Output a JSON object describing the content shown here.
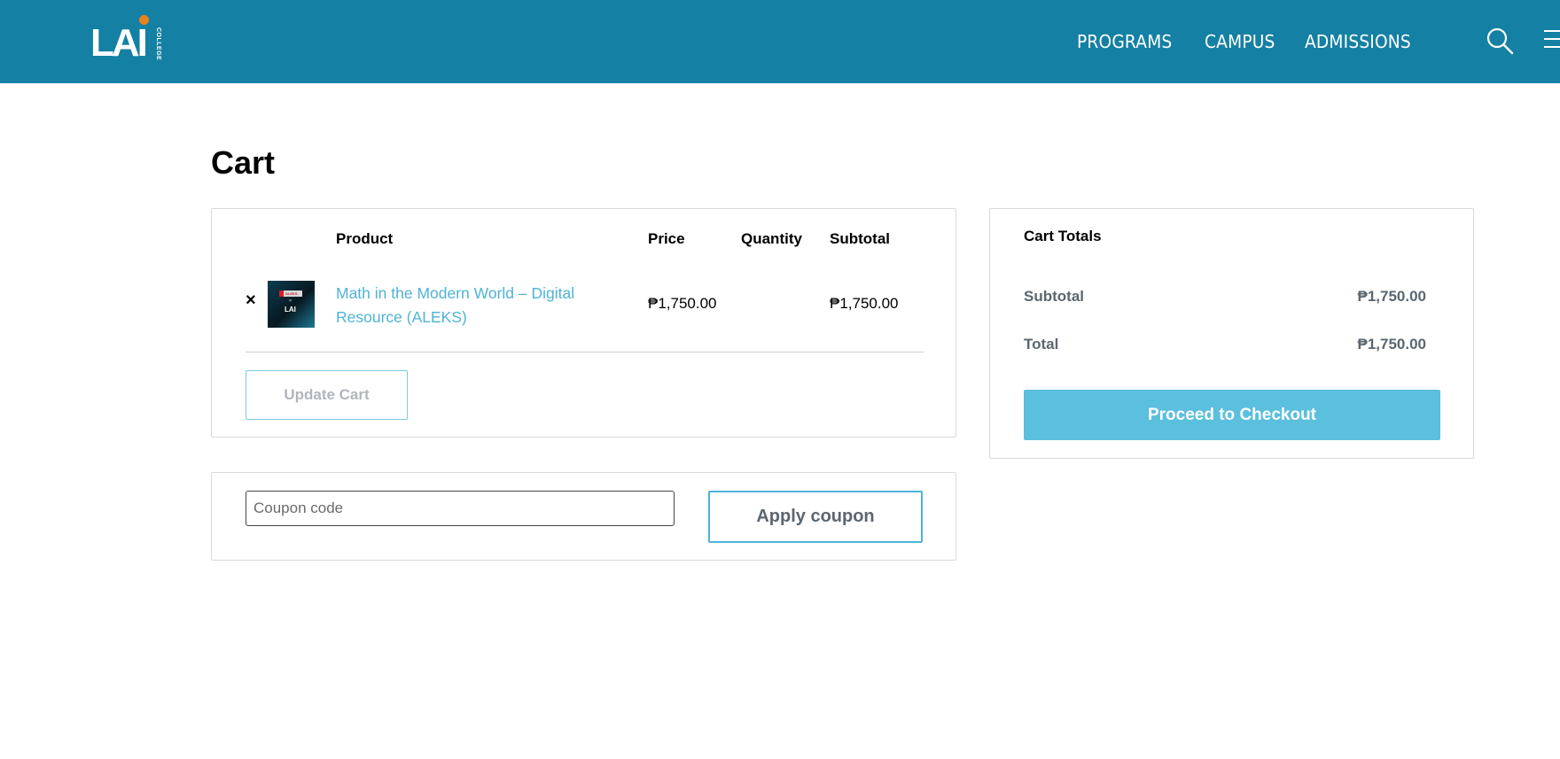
{
  "header": {
    "logo_text": "LAI",
    "logo_sub": "COLLEGE",
    "nav": [
      "PROGRAMS",
      "CAMPUS",
      "ADMISSIONS"
    ]
  },
  "page": {
    "title": "Cart"
  },
  "cart_table": {
    "headers": {
      "product": "Product",
      "price": "Price",
      "quantity": "Quantity",
      "subtotal": "Subtotal"
    },
    "items": [
      {
        "remove_glyph": "×",
        "name": "Math in the Modern World – Digital Resource (ALEKS)",
        "price": "₱1,750.00",
        "quantity": "",
        "subtotal": "₱1,750.00",
        "thumbnail": {
          "brand": "ALEKS",
          "x": "×",
          "lai": "LAI"
        }
      }
    ],
    "update_button": "Update Cart"
  },
  "coupon": {
    "placeholder": "Coupon code",
    "apply_button": "Apply coupon"
  },
  "cart_totals": {
    "title": "Cart Totals",
    "subtotal_label": "Subtotal",
    "subtotal_value": "₱1,750.00",
    "total_label": "Total",
    "total_value": "₱1,750.00",
    "checkout_button": "Proceed to Checkout"
  },
  "colors": {
    "header_bg": "#1480a3",
    "accent": "#4fb3d6",
    "checkout_bg": "#5bbfde",
    "logo_dot": "#e8821e"
  }
}
